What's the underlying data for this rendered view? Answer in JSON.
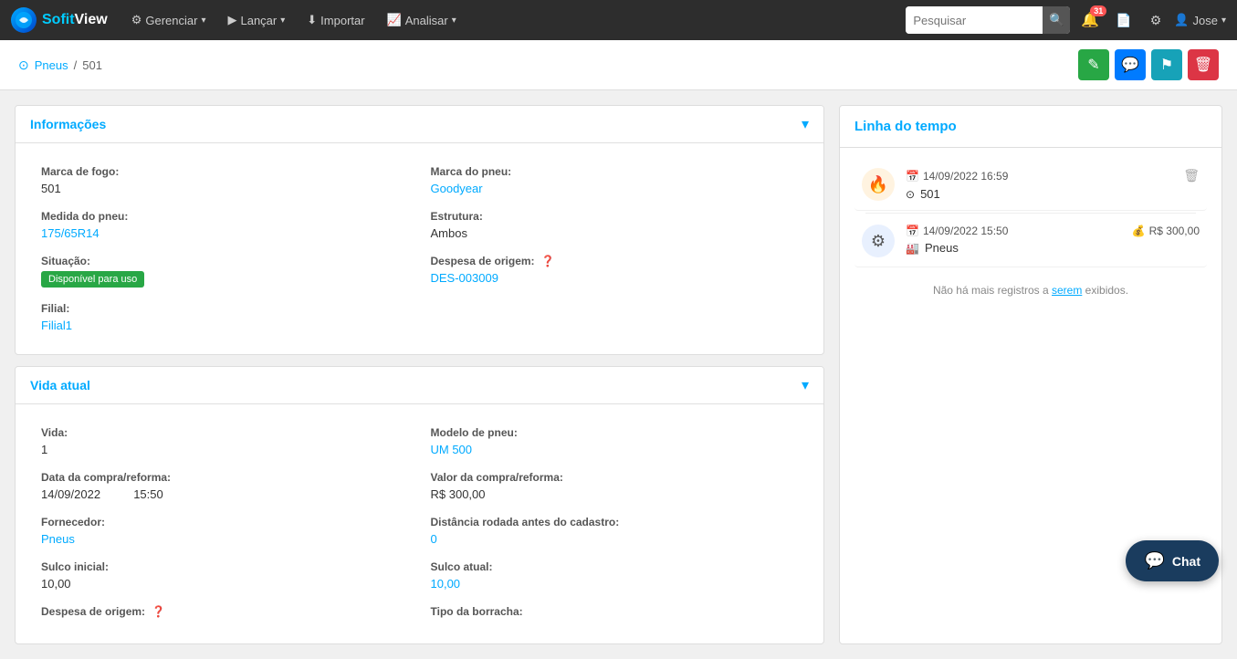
{
  "brand": {
    "logo_text": "S",
    "name_part1": "Sofit",
    "name_part2": "View"
  },
  "navbar": {
    "items": [
      {
        "label": "Gerenciar",
        "has_dropdown": true
      },
      {
        "label": "Lançar",
        "has_dropdown": true
      },
      {
        "label": "Importar",
        "has_dropdown": false
      },
      {
        "label": "Analisar",
        "has_dropdown": true
      }
    ],
    "search_placeholder": "Pesquisar",
    "notification_count": "31",
    "user_name": "Jose"
  },
  "breadcrumb": {
    "icon": "⊙",
    "parent_label": "Pneus",
    "separator": "/",
    "current": "501"
  },
  "actions": {
    "edit_label": "✎",
    "comment_label": "💬",
    "flag_label": "⚑",
    "delete_label": "🗑"
  },
  "informacoes_section": {
    "title": "Informações",
    "fields": {
      "marca_fogo_label": "Marca de fogo:",
      "marca_fogo_value": "501",
      "marca_pneu_label": "Marca do pneu:",
      "marca_pneu_value": "Goodyear",
      "medida_pneu_label": "Medida do pneu:",
      "medida_pneu_value": "175/65R14",
      "estrutura_label": "Estrutura:",
      "estrutura_value": "Ambos",
      "situacao_label": "Situação:",
      "situacao_value": "Disponível para uso",
      "despesa_origem_label": "Despesa de origem:",
      "despesa_origem_value": "DES-003009",
      "filial_label": "Filial:",
      "filial_value": "Filial1"
    }
  },
  "vida_atual_section": {
    "title": "Vida atual",
    "fields": {
      "vida_label": "Vida:",
      "vida_value": "1",
      "modelo_pneu_label": "Modelo de pneu:",
      "modelo_pneu_value": "UM 500",
      "data_compra_label": "Data da compra/reforma:",
      "data_compra_value": "14/09/2022",
      "data_compra_time": "15:50",
      "valor_compra_label": "Valor da compra/reforma:",
      "valor_compra_value": "R$ 300,00",
      "fornecedor_label": "Fornecedor:",
      "fornecedor_value": "Pneus",
      "distancia_label": "Distância rodada antes do cadastro:",
      "distancia_value": "0",
      "sulco_inicial_label": "Sulco inicial:",
      "sulco_inicial_value": "10,00",
      "sulco_atual_label": "Sulco atual:",
      "sulco_atual_value": "10,00",
      "despesa_origem_label": "Despesa de origem:",
      "tipo_borracha_label": "Tipo da borracha:"
    }
  },
  "timeline": {
    "title": "Linha do tempo",
    "items": [
      {
        "type": "fire",
        "date": "14/09/2022 16:59",
        "label": "501",
        "has_delete": true,
        "right_info": null
      },
      {
        "type": "tire",
        "date": "14/09/2022 15:50",
        "label": "Pneus",
        "has_delete": false,
        "right_info": "R$ 300,00"
      }
    ],
    "no_more_text": "Não há mais registros a serem exibidos.",
    "no_more_link_text": "serem"
  },
  "chat": {
    "label": "Chat"
  }
}
